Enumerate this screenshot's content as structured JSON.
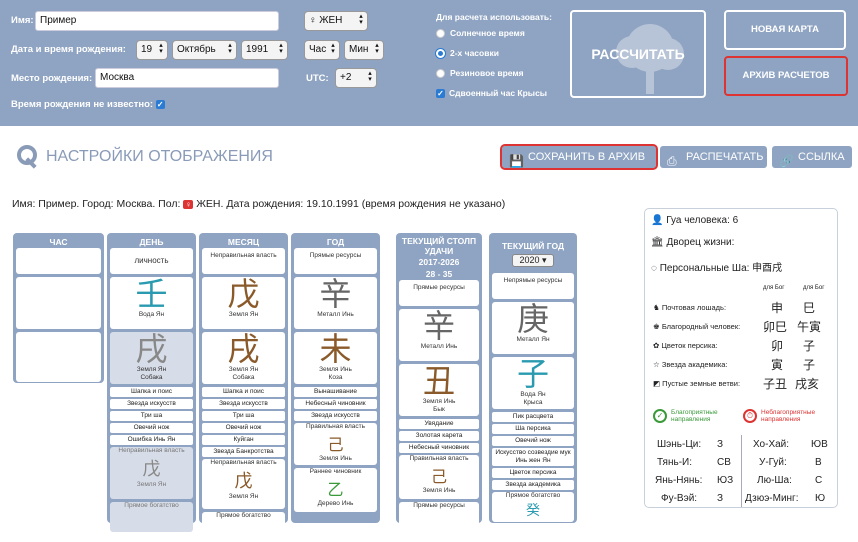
{
  "form": {
    "name_label": "Имя:",
    "name_value": "Пример",
    "gender_value": "ЖЕН",
    "dob_label": "Дата и время рождения:",
    "day": "19",
    "month": "Октябрь",
    "year": "1991",
    "hour": "Час",
    "min": "Мин",
    "place_label": "Место рождения:",
    "place_value": "Москва",
    "utc_label": "UTC:",
    "utc_value": "+2",
    "unknown_label": "Время рождения не известно:",
    "calc_use_label": "Для расчета использовать:",
    "opt_solar": "Солнечное время",
    "opt_2h": "2-х часовки",
    "opt_rubber": "Резиновое время",
    "opt_rat": "Сдвоенный час Крысы",
    "calc_button": "РАССЧИТАТЬ",
    "new_card": "НОВАЯ КАРТА",
    "archive": "АРХИВ РАСЧЕТОВ"
  },
  "toolbar": {
    "title": "НАСТРОЙКИ ОТОБРАЖЕНИЯ",
    "save": "СОХРАНИТЬ В АРХИВ",
    "print": "РАСПЕЧАТАТЬ",
    "link": "ССЫЛКА"
  },
  "summary": {
    "prefix": "Имя: Пример. Город: Москва. Пол:",
    "gender_icon": "♀",
    "suffix": "ЖЕН. Дата рождения: 19.10.1991 (время рождения не указано)"
  },
  "columns": {
    "hour": "ЧАС",
    "day": "ДЕНЬ",
    "month": "МЕСЯЦ",
    "year": "ГОД",
    "luck": "ТЕКУЩИЙ СТОЛП УДАЧИ",
    "luck_years": "2017-2026",
    "luck_ages": "28 - 35",
    "cur_year": "ТЕКУЩИЙ ГОД",
    "cur_year_value": "2020"
  },
  "day": {
    "role": "личность",
    "stem": "壬",
    "stem_label": "Вода Ян",
    "branch": "戌",
    "branch_label1": "Земля Ян",
    "branch_label2": "Собака",
    "tags": [
      "Шапка и поис",
      "Звезда искусств",
      "Три ша",
      "Овечий нож",
      "Ошибка Инь Ян"
    ],
    "h1": "Неправильная власть",
    "h1b": "戊",
    "h1c": "Земля Ян",
    "h2": "Прямое богатство"
  },
  "month": {
    "role": "Неправильная власть",
    "stem": "戊",
    "stem_label": "Земля Ян",
    "branch": "戌",
    "branch_label1": "Земля Ян",
    "branch_label2": "Собака",
    "tags": [
      "Шапка и поис",
      "Звезда искусств",
      "Три ша",
      "Овечий нож",
      "Куйган",
      "Звезда Банкротства"
    ],
    "h1": "Неправильная власть",
    "h1b": "戊",
    "h1c": "Земля Ян",
    "h2": "Прямое богатство"
  },
  "year": {
    "role": "Прямые ресурсы",
    "stem": "辛",
    "stem_label": "Металл Инь",
    "branch": "未",
    "branch_label1": "Земля Инь",
    "branch_label2": "Коза",
    "tags": [
      "Вынашивание",
      "Небесный чиновник",
      "Звезда искусств"
    ],
    "h1": "Правильная власть",
    "h1b": "己",
    "h1c": "Земля Инь",
    "h2": "Раннее чиновник",
    "h2b": "乙",
    "h2c": "Дерево Инь"
  },
  "luck": {
    "role": "Прямые ресурсы",
    "stem": "辛",
    "stem_label": "Металл Инь",
    "branch": "丑",
    "branch_label1": "Земля Инь",
    "branch_label2": "Бык",
    "tags": [
      "Увядание",
      "Золотая карета",
      "Небесный чиновник"
    ],
    "h1": "Правильная власть",
    "h1b": "己",
    "h1c": "Земля Инь",
    "h2": "Прямые ресурсы"
  },
  "cy": {
    "role": "Непрямые ресурсы",
    "stem": "庚",
    "stem_label": "Металл Ян",
    "branch": "子",
    "branch_label1": "Вода Ян",
    "branch_label2": "Крыса",
    "tags": [
      "Пик расцвета",
      "Ша персика",
      "Овечий нож",
      "Искусство созвездие мук Инь жен Ян",
      "Цветок персика",
      "Звезда академика"
    ],
    "h1": "Прямое богатство",
    "h1b": "癸"
  },
  "info": {
    "gua": "Гуа человека: 6",
    "palace": "Дворец жизни:",
    "sha": "Персональные Ша: 申酉戌",
    "col1": "для Бог",
    "col2": "для Бог",
    "stars": [
      {
        "name": "Почтовая лошадь:",
        "a": "申",
        "b": "巳"
      },
      {
        "name": "Благородный человек:",
        "a": "卯巳",
        "b": "午寅"
      },
      {
        "name": "Цветок персика:",
        "a": "卯",
        "b": "子"
      },
      {
        "name": "Звезда академика:",
        "a": "寅",
        "b": "子"
      },
      {
        "name": "Пустые земные ветви:",
        "a": "子丑",
        "b": "戌亥"
      }
    ],
    "good": "Благоприятные направления",
    "bad": "Неблагоприятные направления",
    "dirs": [
      {
        "a": "Шэнь-Ци:",
        "av": "З",
        "b": "Хо-Хай:",
        "bv": "ЮВ"
      },
      {
        "a": "Тянь-И:",
        "av": "СВ",
        "b": "У-Гуй:",
        "bv": "В"
      },
      {
        "a": "Янь-Нянь:",
        "av": "ЮЗ",
        "b": "Лю-Ша:",
        "bv": "С"
      },
      {
        "a": "Фу-Вэй:",
        "av": "З",
        "b": "Дзюэ-Минг:",
        "bv": "Ю"
      }
    ]
  }
}
